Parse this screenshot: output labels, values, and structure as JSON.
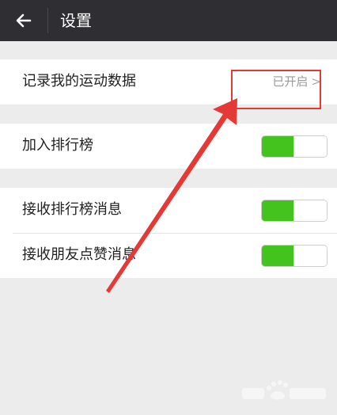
{
  "header": {
    "title": "设置",
    "back_icon": "arrow-left-icon"
  },
  "sections": [
    {
      "items": [
        {
          "label": "记录我的运动数据",
          "value": "已开启",
          "chevron": ">"
        }
      ]
    },
    {
      "items": [
        {
          "label": "加入排行榜",
          "toggle": {
            "on": true,
            "level": 0.5
          }
        }
      ]
    },
    {
      "items": [
        {
          "label": "接收排行榜消息",
          "toggle": {
            "on": true,
            "level": 0.5
          }
        },
        {
          "label": "接收朋友点赞消息",
          "toggle": {
            "on": true,
            "level": 0.5
          }
        }
      ]
    }
  ],
  "colors": {
    "header_bg": "#2f2f33",
    "background": "#ececec",
    "toggle_on": "#44c31f",
    "annotation": "#e53935"
  }
}
